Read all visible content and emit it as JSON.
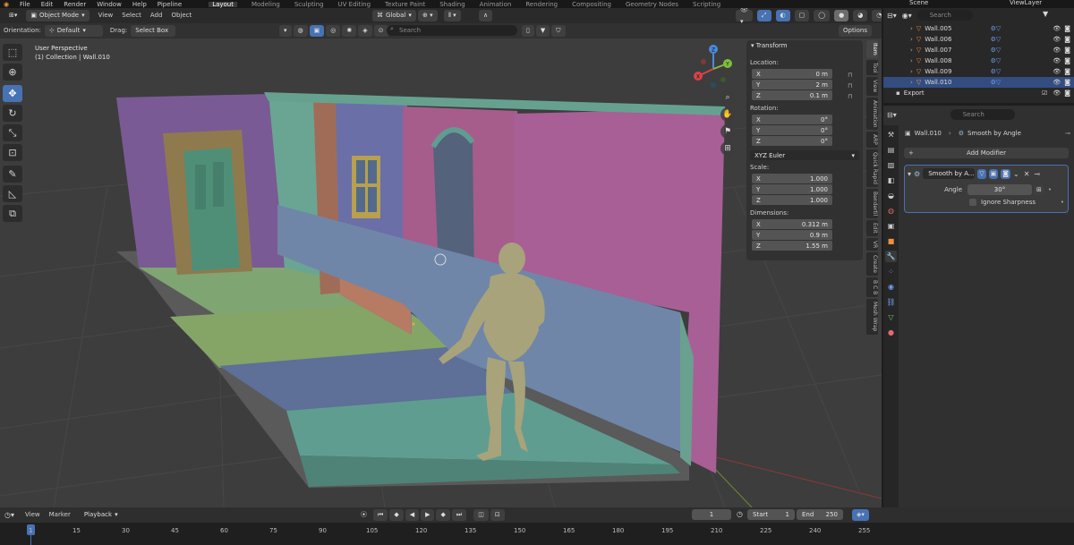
{
  "menu": {
    "items": [
      "File",
      "Edit",
      "Render",
      "Window",
      "Help",
      "Pipeline"
    ],
    "workspaces": [
      "Layout",
      "Modeling",
      "Sculpting",
      "UV Editing",
      "Texture Paint",
      "Shading",
      "Animation",
      "Rendering",
      "Compositing",
      "Geometry Nodes",
      "Scripting"
    ],
    "active_workspace": "Layout",
    "scene_label": "Scene",
    "view_layer_label": "ViewLayer"
  },
  "viewport_header": {
    "mode": "Object Mode",
    "menu": [
      "View",
      "Select",
      "Add",
      "Object"
    ],
    "transform_orientation": "Global",
    "orientation_label": "Orientation:",
    "orientation_value": "Default",
    "drag_label": "Drag:",
    "drag_value": "Select Box",
    "search_placeholder": "Search",
    "options_label": "Options"
  },
  "viewport_info": {
    "perspective": "User Perspective",
    "collection": "(1) Collection | Wall.010"
  },
  "npanel": {
    "title": "Transform",
    "location_label": "Location:",
    "location": [
      {
        "axis": "X",
        "value": "0 m"
      },
      {
        "axis": "Y",
        "value": "2 m"
      },
      {
        "axis": "Z",
        "value": "0.1 m"
      }
    ],
    "rotation_label": "Rotation:",
    "rotation": [
      {
        "axis": "X",
        "value": "0°"
      },
      {
        "axis": "Y",
        "value": "0°"
      },
      {
        "axis": "Z",
        "value": "0°"
      }
    ],
    "rotation_mode": "XYZ Euler",
    "scale_label": "Scale:",
    "scale": [
      {
        "axis": "X",
        "value": "1.000"
      },
      {
        "axis": "Y",
        "value": "1.000"
      },
      {
        "axis": "Z",
        "value": "1.000"
      }
    ],
    "dimensions_label": "Dimensions:",
    "dimensions": [
      {
        "axis": "X",
        "value": "0.312 m"
      },
      {
        "axis": "Y",
        "value": "0.9 m"
      },
      {
        "axis": "Z",
        "value": "1.55 m"
      }
    ],
    "tabs": [
      "Item",
      "Tool",
      "View",
      "Animation",
      "ARP",
      "Quick Rapid",
      "Bendertil",
      "Edit",
      "VR",
      "Create",
      "B C B",
      "Mesh Wrap"
    ]
  },
  "outliner": {
    "search_placeholder": "Search",
    "rows": [
      "Wall.005",
      "Wall.006",
      "Wall.007",
      "Wall.008",
      "Wall.009",
      "Wall.010"
    ],
    "export_label": "Export"
  },
  "properties": {
    "search_placeholder": "Search",
    "object_name": "Wall.010",
    "modifier_breadcrumb": "Smooth by Angle",
    "add_modifier_label": "Add Modifier",
    "modifier_name": "Smooth by A...",
    "angle_label": "Angle",
    "angle_value": "30°",
    "ignore_sharpness_label": "Ignore Sharpness"
  },
  "timeline": {
    "menu": [
      "View",
      "Marker"
    ],
    "playback_label": "Playback",
    "current_frame": "1",
    "start_label": "Start",
    "start_value": "1",
    "end_label": "End",
    "end_value": "250",
    "ruler_marks": [
      "1",
      "15",
      "30",
      "45",
      "60",
      "75",
      "90",
      "105",
      "120",
      "135",
      "150",
      "165",
      "180",
      "195",
      "210",
      "225",
      "240",
      "255"
    ]
  },
  "colors": {
    "accent": "#4772b3",
    "viewport_bg": "#3d3d3d",
    "panel_bg": "#303030",
    "wall_purple": "#7a5a94",
    "wall_pink": "#a65d8c",
    "wall_blue": "#6272a8",
    "floor_green": "#7fa572",
    "floor_blue": "#5e6f98",
    "floor_teal": "#5f9d91",
    "figure": "#a8a37a"
  }
}
